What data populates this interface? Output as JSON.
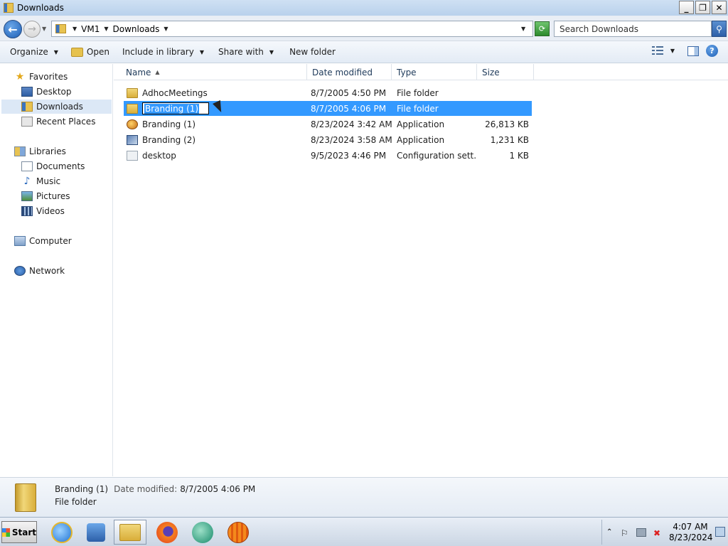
{
  "window": {
    "title": "Downloads",
    "minimize": "_",
    "restore": "❐",
    "close": "✕"
  },
  "address": {
    "crumbs": [
      "VM1",
      "Downloads"
    ],
    "search_placeholder": "Search Downloads"
  },
  "toolbar": {
    "organize": "Organize",
    "open": "Open",
    "include_in_library": "Include in library",
    "share_with": "Share with",
    "new_folder": "New folder"
  },
  "nav": {
    "favorites": "Favorites",
    "desktop": "Desktop",
    "downloads": "Downloads",
    "recent_places": "Recent Places",
    "libraries": "Libraries",
    "documents": "Documents",
    "music": "Music",
    "pictures": "Pictures",
    "videos": "Videos",
    "computer": "Computer",
    "network": "Network"
  },
  "columns": {
    "name": "Name",
    "date": "Date modified",
    "type": "Type",
    "size": "Size"
  },
  "files": [
    {
      "name": "AdhocMeetings",
      "date": "8/7/2005 4:50 PM",
      "type": "File folder",
      "size": "",
      "icon": "folder-icon"
    },
    {
      "name": "Branding (1)",
      "date": "8/7/2005 4:06 PM",
      "type": "File folder",
      "size": "",
      "icon": "folder-icon",
      "selected": true,
      "renaming": true
    },
    {
      "name": "Branding (1)",
      "date": "8/23/2024 3:42 AM",
      "type": "Application",
      "size": "26,813 KB",
      "icon": "application-icon"
    },
    {
      "name": "Branding (2)",
      "date": "8/23/2024 3:58 AM",
      "type": "Application",
      "size": "1,231 KB",
      "icon": "application-icon"
    },
    {
      "name": "desktop",
      "date": "9/5/2023 4:46 PM",
      "type": "Configuration sett...",
      "size": "1 KB",
      "icon": "config-file-icon"
    }
  ],
  "details": {
    "name": "Branding (1)",
    "date_label": "Date modified:",
    "date_value": "8/7/2005 4:06 PM",
    "type": "File folder"
  },
  "taskbar": {
    "start": "Start",
    "time": "4:07 AM",
    "date": "8/23/2024"
  },
  "colors": {
    "selection": "#3399ff",
    "accent": "#1d5fb6"
  }
}
